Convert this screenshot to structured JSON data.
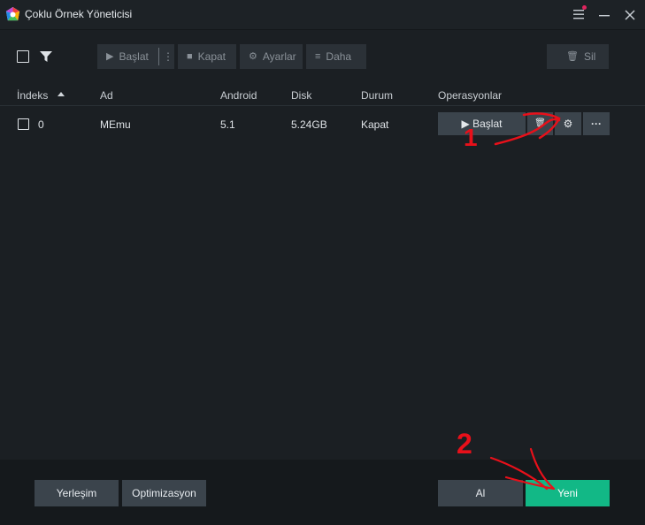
{
  "window": {
    "title": "Çoklu Örnek Yöneticisi",
    "menu_icon": "hamburger-icon",
    "minimize_icon": "minimize-icon",
    "close_icon": "close-icon",
    "notification_color": "#e0245e"
  },
  "toolbar": {
    "start_label": "Başlat",
    "more_dots": "⋮",
    "stop_label": "Kapat",
    "settings_label": "Ayarlar",
    "more_label": "Daha",
    "delete_label": "Sil"
  },
  "table": {
    "columns": [
      "İndeks",
      "Ad",
      "Android",
      "Disk",
      "Durum",
      "Operasyonlar"
    ],
    "rows": [
      {
        "index": "0",
        "name": "MEmu",
        "android": "5.1",
        "disk": "5.24GB",
        "status": "Kapat",
        "start_label": "Başlat",
        "more_label": "···"
      }
    ]
  },
  "footer": {
    "arrange_label": "Yerleşim",
    "optimize_label": "Optimizasyon",
    "import_label": "Al",
    "new_label": "Yeni"
  },
  "annotations": {
    "marker_1": "1",
    "marker_2": "2",
    "color": "#e8101a"
  },
  "colors": {
    "accent": "#12b886",
    "background": "#1b1f23",
    "button": "#3b444c"
  }
}
